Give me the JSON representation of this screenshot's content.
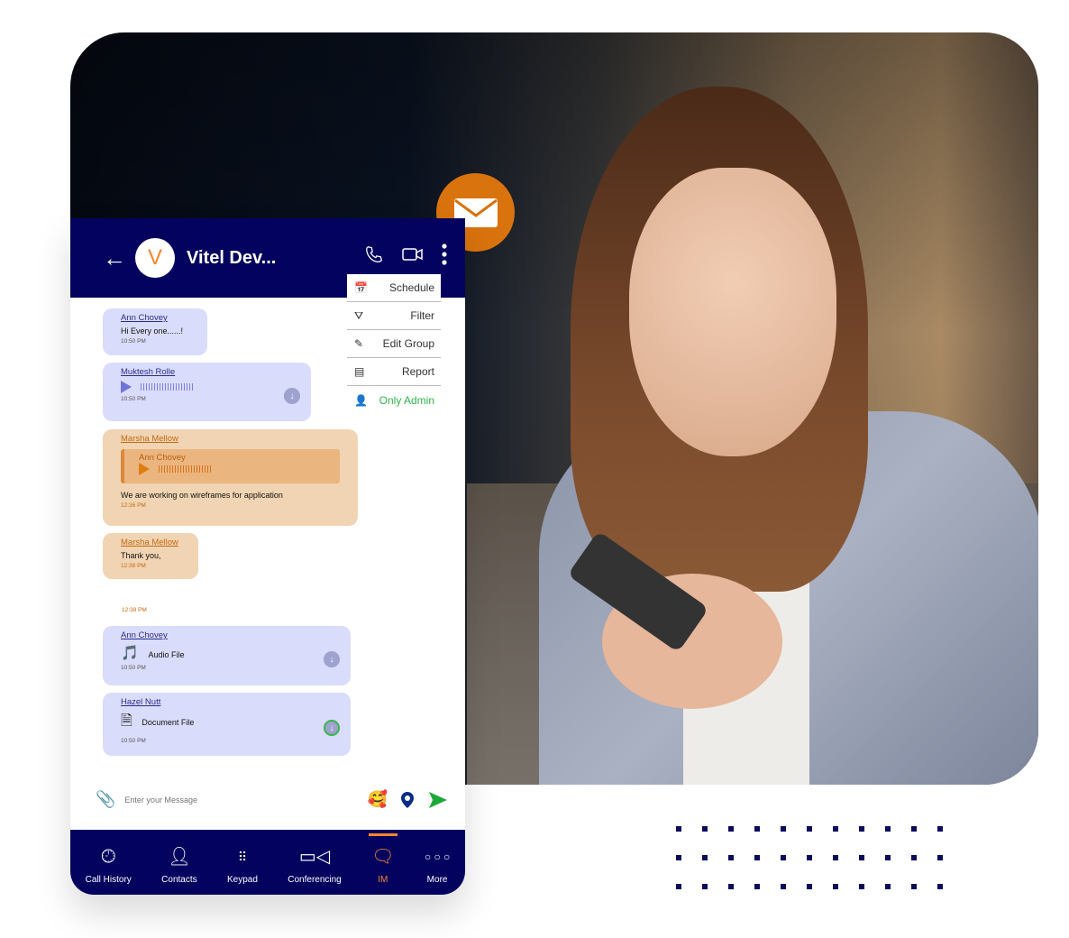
{
  "header": {
    "title": "Vitel Dev...",
    "avatar_letter": "V"
  },
  "menu": [
    {
      "label": "Schedule",
      "icon": "calendar-clock-icon"
    },
    {
      "label": "Filter",
      "icon": "filter-icon"
    },
    {
      "label": "Edit Group",
      "icon": "pencil-icon"
    },
    {
      "label": "Report",
      "icon": "report-icon"
    },
    {
      "label": "Only Admin",
      "icon": "admin-icon"
    }
  ],
  "messages": [
    {
      "sender": "Ann Chovey",
      "text": "Hi Every one......!",
      "time": "10:50 PM"
    },
    {
      "sender": "Muktesh Rolle",
      "time": "10:50 PM"
    },
    {
      "sender": "Marsha Mellow",
      "quoted": "Ann Chovey",
      "text": "We are working on wireframes for application",
      "time": "12:36 PM"
    },
    {
      "sender": "Marsha Mellow",
      "text": "Thank you,",
      "time": "12:38 PM"
    },
    {
      "time": "12:38 PM"
    },
    {
      "sender": "Ann Chovey",
      "text": "Audio File",
      "time": "10:50 PM"
    },
    {
      "sender": "Hazel Nutt",
      "text": "Document File",
      "time": "10:50 PM"
    }
  ],
  "input": {
    "placeholder": "Enter your Message"
  },
  "nav": [
    {
      "label": "Call History"
    },
    {
      "label": "Contacts"
    },
    {
      "label": "Keypad"
    },
    {
      "label": "Conferencing"
    },
    {
      "label": "IM",
      "active": true
    },
    {
      "label": "More"
    }
  ],
  "colors": {
    "navy": "#03035f",
    "accent": "#f5862b",
    "mail": "#d9730d",
    "green": "#2fb34a"
  }
}
